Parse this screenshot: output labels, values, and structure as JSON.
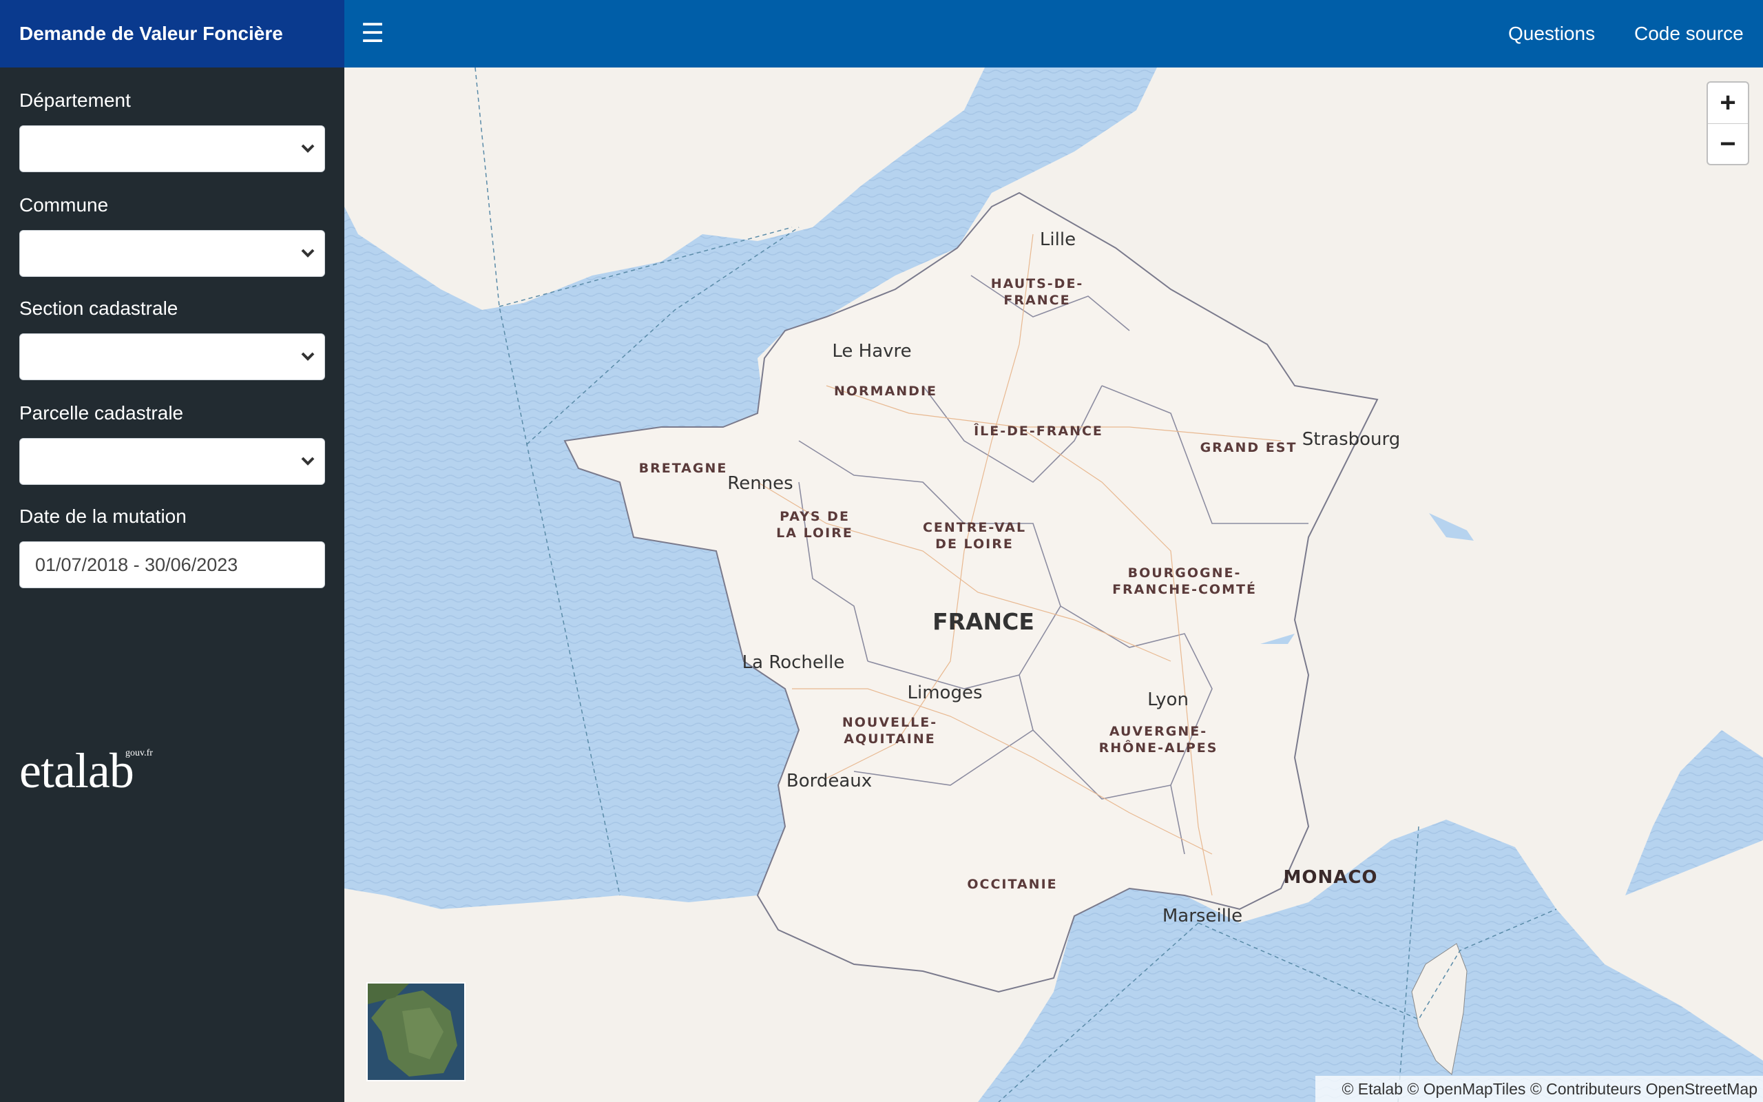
{
  "header": {
    "title": "Demande de Valeur Foncière",
    "menu_icon": "hamburger-icon",
    "nav": [
      {
        "label": "Questions"
      },
      {
        "label": "Code source"
      }
    ]
  },
  "sidebar": {
    "fields": [
      {
        "label": "Département",
        "value": ""
      },
      {
        "label": "Commune",
        "value": ""
      },
      {
        "label": "Section cadastrale",
        "value": ""
      },
      {
        "label": "Parcelle cadastrale",
        "value": ""
      }
    ],
    "date": {
      "label": "Date de la mutation",
      "value": "01/07/2018 - 30/06/2023"
    },
    "logo": {
      "text": "etalab",
      "suffix": "gouv.fr"
    }
  },
  "map": {
    "country": "FRANCE",
    "cities": [
      "Lille",
      "Le Havre",
      "Strasbourg",
      "Rennes",
      "La Rochelle",
      "Limoges",
      "Lyon",
      "Bordeaux",
      "Marseille"
    ],
    "regions": [
      "HAUTS-DE-",
      "FRANCE",
      "NORMANDIE",
      "ÎLE-DE-FRANCE",
      "GRAND EST",
      "BRETAGNE",
      "PAYS DE",
      "LA LOIRE",
      "CENTRE-VAL",
      "DE LOIRE",
      "BOURGOGNE-",
      "FRANCHE-COMTÉ",
      "NOUVELLE-",
      "AQUITAINE",
      "AUVERGNE-",
      "RHÔNE-ALPES",
      "OCCITANIE"
    ],
    "monaco": "MONACO",
    "zoom_in": "+",
    "zoom_out": "−",
    "attribution": "© Etalab © OpenMapTiles © Contributeurs OpenStreetMap"
  },
  "colors": {
    "header": "#005ea8",
    "brand": "#0a3a8e",
    "sidebar": "#222b31",
    "sea": "#b6d3ef",
    "land": "#f4f1ec"
  }
}
